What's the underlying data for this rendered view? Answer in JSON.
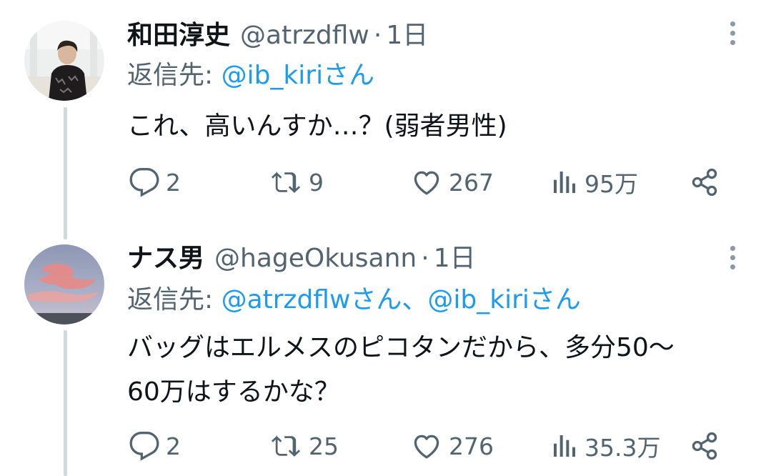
{
  "tweets": [
    {
      "name": "和田淳史",
      "handle": "@atrzdflw",
      "separator": "·",
      "time": "1日",
      "reply_prefix": "返信先: ",
      "reply_to": "@ib_kiriさん",
      "text": "これ、高いんすか…？(弱者男性)",
      "avatar_icon": "profile-photo-person",
      "stats": {
        "replies": "2",
        "retweets": "9",
        "likes": "267",
        "views": "95万"
      }
    },
    {
      "name": "ナス男",
      "handle": "@hageOkusann",
      "separator": "·",
      "time": "1日",
      "reply_prefix": "返信先: ",
      "reply_to": "@atrzdflwさん、@ib_kiriさん",
      "text_line1": "バッグはエルメスのピコタンだから、多分50〜",
      "text_line2": "60万はするかな？",
      "avatar_icon": "profile-photo-sunset-sky",
      "stats": {
        "replies": "2",
        "retweets": "25",
        "likes": "276",
        "views": "35.3万"
      }
    }
  ],
  "colors": {
    "text": "#0f1419",
    "secondary": "#536471",
    "link": "#1d9bf0",
    "thread_line": "#cfd9de"
  },
  "icons": [
    "reply-icon",
    "retweet-icon",
    "like-icon",
    "views-icon",
    "share-icon",
    "more-icon"
  ]
}
